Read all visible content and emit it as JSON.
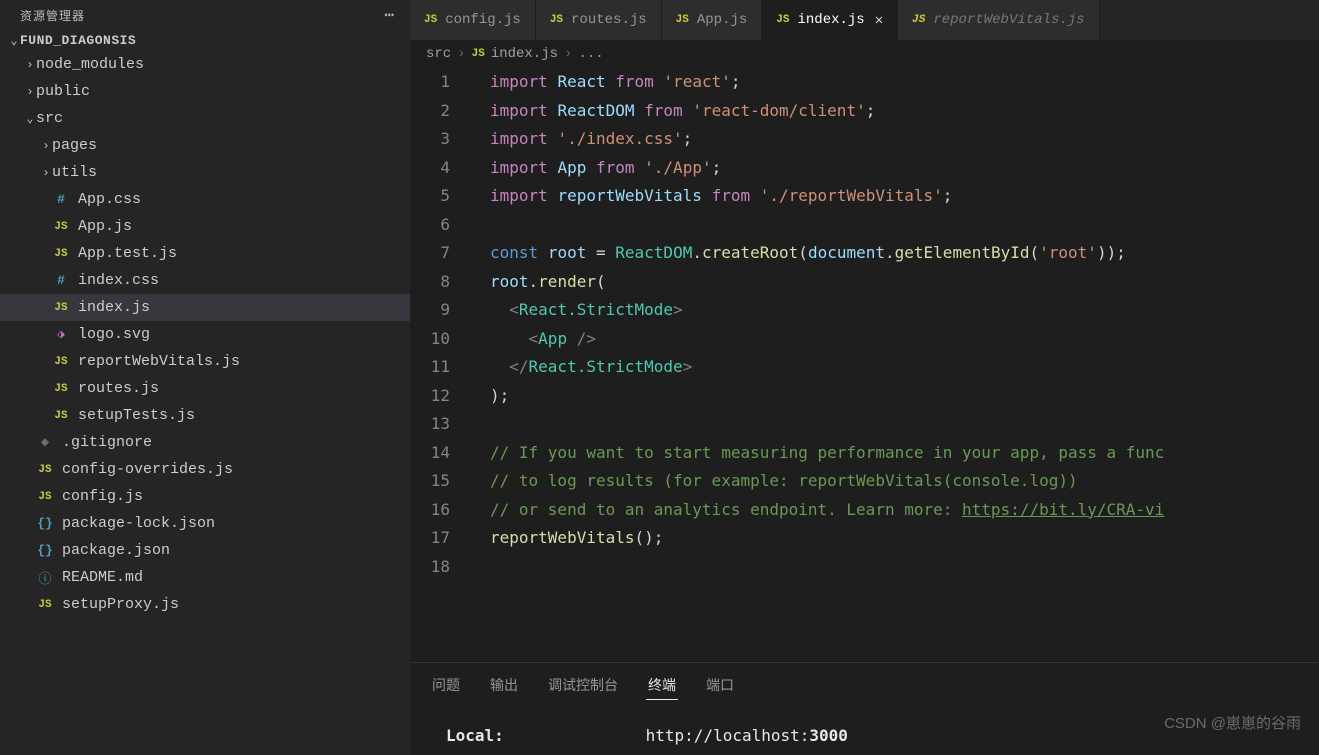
{
  "sidebar": {
    "title": "资源管理器",
    "project": "FUND_DIAGONSIS",
    "tree": [
      {
        "indent": 24,
        "chev": "›",
        "icon": "",
        "cls": "",
        "name": "node_modules"
      },
      {
        "indent": 24,
        "chev": "›",
        "icon": "",
        "cls": "",
        "name": "public"
      },
      {
        "indent": 24,
        "chev": "⌄",
        "icon": "",
        "cls": "",
        "name": "src"
      },
      {
        "indent": 40,
        "chev": "›",
        "icon": "",
        "cls": "",
        "name": "pages"
      },
      {
        "indent": 40,
        "chev": "›",
        "icon": "",
        "cls": "",
        "name": "utils"
      },
      {
        "indent": 40,
        "chev": "",
        "icon": "#",
        "cls": "icon-css",
        "name": "App.css"
      },
      {
        "indent": 40,
        "chev": "",
        "icon": "JS",
        "cls": "icon-js",
        "name": "App.js"
      },
      {
        "indent": 40,
        "chev": "",
        "icon": "JS",
        "cls": "icon-js",
        "name": "App.test.js"
      },
      {
        "indent": 40,
        "chev": "",
        "icon": "#",
        "cls": "icon-css",
        "name": "index.css"
      },
      {
        "indent": 40,
        "chev": "",
        "icon": "JS",
        "cls": "icon-js",
        "name": "index.js",
        "active": true
      },
      {
        "indent": 40,
        "chev": "",
        "icon": "⬗",
        "cls": "icon-svg",
        "name": "logo.svg"
      },
      {
        "indent": 40,
        "chev": "",
        "icon": "JS",
        "cls": "icon-js",
        "name": "reportWebVitals.js"
      },
      {
        "indent": 40,
        "chev": "",
        "icon": "JS",
        "cls": "icon-js",
        "name": "routes.js"
      },
      {
        "indent": 40,
        "chev": "",
        "icon": "JS",
        "cls": "icon-js",
        "name": "setupTests.js"
      },
      {
        "indent": 24,
        "chev": "",
        "icon": "◆",
        "cls": "icon-git",
        "name": ".gitignore"
      },
      {
        "indent": 24,
        "chev": "",
        "icon": "JS",
        "cls": "icon-js",
        "name": "config-overrides.js"
      },
      {
        "indent": 24,
        "chev": "",
        "icon": "JS",
        "cls": "icon-js",
        "name": "config.js"
      },
      {
        "indent": 24,
        "chev": "",
        "icon": "{}",
        "cls": "icon-braces",
        "name": "package-lock.json"
      },
      {
        "indent": 24,
        "chev": "",
        "icon": "{}",
        "cls": "icon-braces",
        "name": "package.json"
      },
      {
        "indent": 24,
        "chev": "",
        "icon": "ⓘ",
        "cls": "icon-info",
        "name": "README.md"
      },
      {
        "indent": 24,
        "chev": "",
        "icon": "JS",
        "cls": "icon-js",
        "name": "setupProxy.js"
      }
    ]
  },
  "tabs": [
    {
      "name": "config.js",
      "active": false,
      "italic": false
    },
    {
      "name": "routes.js",
      "active": false,
      "italic": false
    },
    {
      "name": "App.js",
      "active": false,
      "italic": false
    },
    {
      "name": "index.js",
      "active": true,
      "italic": false,
      "close": true
    },
    {
      "name": "reportWebVitals.js",
      "active": false,
      "italic": true
    }
  ],
  "breadcrumb": {
    "root": "src",
    "file": "index.js",
    "more": "..."
  },
  "code_lines": [
    "<span class='kw'>import</span> <span class='var'>React</span> <span class='kw'>from</span> <span class='str'>'react'</span>;",
    "<span class='kw'>import</span> <span class='var'>ReactDOM</span> <span class='kw'>from</span> <span class='str'>'react-dom/client'</span>;",
    "<span class='kw'>import</span> <span class='str'>'./index.css'</span>;",
    "<span class='kw'>import</span> <span class='var'>App</span> <span class='kw'>from</span> <span class='str'>'./App'</span>;",
    "<span class='kw'>import</span> <span class='var'>reportWebVitals</span> <span class='kw'>from</span> <span class='str'>'./reportWebVitals'</span>;",
    "",
    "<span class='blu'>const</span> <span class='var'>root</span> <span class='wht'>=</span> <span class='cls'>ReactDOM</span>.<span class='fn'>createRoot</span>(<span class='var'>document</span>.<span class='fn'>getElementById</span>(<span class='str'>'root'</span>));",
    "<span class='var'>root</span>.<span class='fn'>render</span>(",
    "  <span class='pct'>&lt;</span><span class='tag'>React.StrictMode</span><span class='pct'>&gt;</span>",
    "    <span class='pct'>&lt;</span><span class='tag'>App</span> <span class='pct'>/&gt;</span>",
    "  <span class='pct'>&lt;/</span><span class='tag'>React.StrictMode</span><span class='pct'>&gt;</span>",
    ");",
    "",
    "<span class='cmt'>// If you want to start measuring performance in your app, pass a func</span>",
    "<span class='cmt'>// to log results (for example: reportWebVitals(console.log))</span>",
    "<span class='cmt'>// or send to an analytics endpoint. Learn more: <span class='link'>https://bit.ly/CRA-vi</span></span>",
    "<span class='fn'>reportWebVitals</span>();",
    ""
  ],
  "panel": {
    "tabs": [
      "问题",
      "输出",
      "调试控制台",
      "终端",
      "端口"
    ],
    "active": 3,
    "local_label": "Local:",
    "local_url_pre": "http://localhost:",
    "local_url_port": "3000"
  },
  "watermark": "CSDN @崽崽的谷雨"
}
